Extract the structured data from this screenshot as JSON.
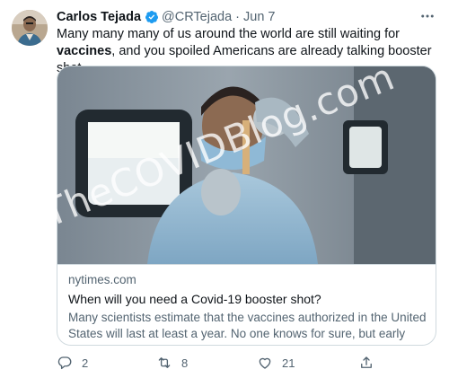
{
  "tweet": {
    "author_name": "Carlos Tejada",
    "handle": "@CRTejada",
    "separator": "·",
    "date": "Jun 7",
    "text_before": "Many many many of us around the world are still waiting for ",
    "text_bold": "vaccines",
    "text_after": ", and you spoiled Americans are already talking booster shot."
  },
  "card": {
    "domain": "nytimes.com",
    "title": "When will you need a Covid-19 booster shot?",
    "description": "Many scientists estimate that the vaccines authorized in the United States will last at least a year. No one knows for sure, but early signs ..."
  },
  "watermark": "TheCOVIDBlog.com",
  "actions": {
    "reply_count": "2",
    "retweet_count": "8",
    "like_count": "21"
  },
  "icons": {
    "verified": "verified-badge-icon",
    "more": "more-icon",
    "reply": "reply-icon",
    "retweet": "retweet-icon",
    "like": "like-icon",
    "share": "share-icon"
  },
  "colors": {
    "verified": "#1d9bf0",
    "secondary_text": "#536471",
    "border": "#cfd9de"
  }
}
